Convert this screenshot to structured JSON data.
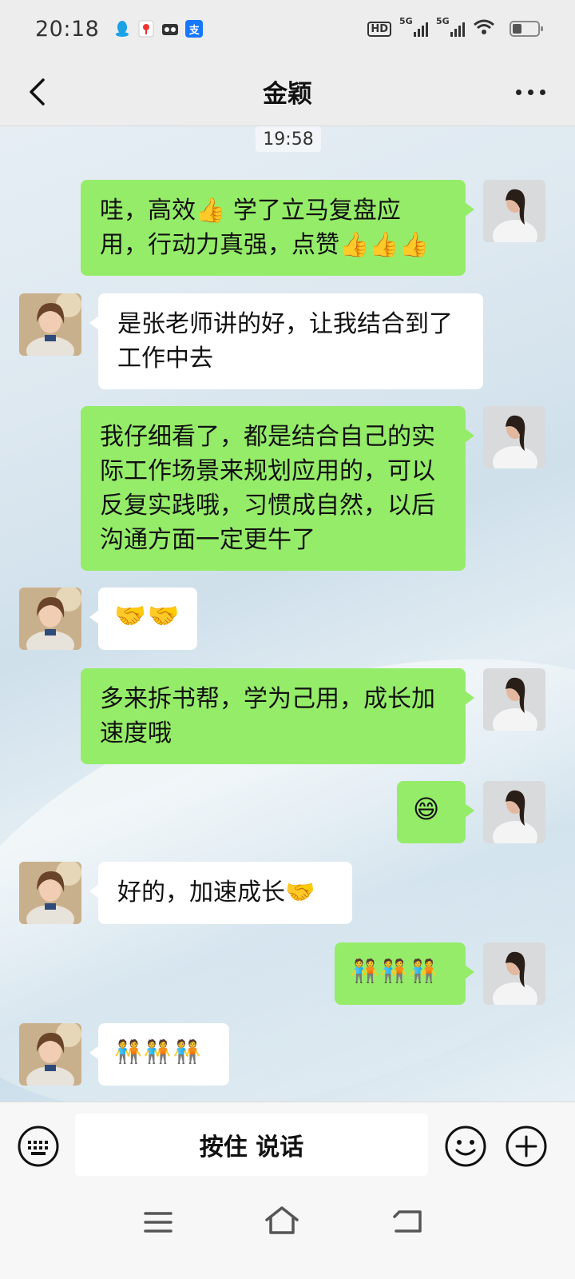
{
  "status_bar": {
    "time": "20:18",
    "apps": [
      {
        "icon": "qq-icon",
        "glyph": "🐧",
        "color": "#1aa1e6"
      },
      {
        "icon": "map-pin-app-icon",
        "glyph": "📍",
        "color": "#ffffff"
      },
      {
        "icon": "radio-app-icon",
        "glyph": "📻",
        "color": "#ffffff"
      },
      {
        "icon": "alipay-icon",
        "glyph": "支",
        "color": "#1677ff"
      }
    ],
    "hd": "HD",
    "signal_1_label": "5G",
    "signal_2_label": "5G",
    "battery_level": 0.35
  },
  "header": {
    "title": "金颖"
  },
  "chat": {
    "timestamp": "19:58",
    "messages": [
      {
        "side": "me",
        "text": "哇，高效👍 学了立马复盘应用，行动力真强，点赞👍👍👍"
      },
      {
        "side": "them",
        "text": "是张老师讲的好，让我结合到了工作中去"
      },
      {
        "side": "me",
        "text": "我仔细看了，都是结合自己的实际工作场景来规划应用的，可以反复实践哦，习惯成自然，以后沟通方面一定更牛了"
      },
      {
        "side": "them",
        "text": "🤝🤝"
      },
      {
        "side": "me",
        "text": "多来拆书帮，学为己用，成长加速度哦"
      },
      {
        "side": "me",
        "text": "😄"
      },
      {
        "side": "them",
        "text": "好的，加速成长🤝"
      },
      {
        "side": "me",
        "text": "🧑‍🤝‍🧑🧑‍🤝‍🧑🧑‍🤝‍🧑"
      },
      {
        "side": "them",
        "text": "🧑‍🤝‍🧑🧑‍🤝‍🧑🧑‍🤝‍🧑"
      }
    ]
  },
  "input_bar": {
    "hold_to_talk": "按住 说话"
  },
  "colors": {
    "my_bubble": "#95ec69",
    "their_bubble": "#ffffff",
    "bar_bg": "#ededed"
  }
}
